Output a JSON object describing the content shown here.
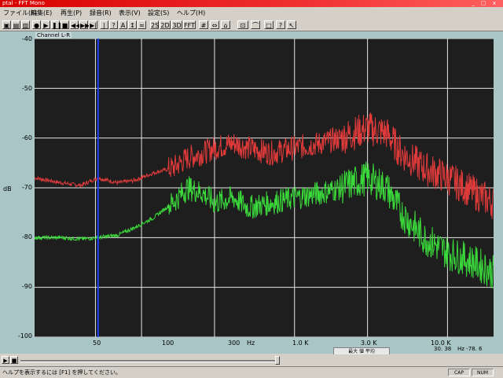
{
  "window": {
    "title": "ptal - FFT Mono",
    "controls": "_ □ x"
  },
  "menu": [
    "ファイル(F)",
    "編集(E)",
    "再生(P)",
    "録音(R)",
    "表示(V)",
    "設定(S)",
    "ヘルプ(H)"
  ],
  "toolbar": [
    "2S",
    "2D",
    "3D",
    "FFT"
  ],
  "graph": {
    "tab_label": "Channel L-R",
    "y_unit": "dB",
    "x_unit": "Hz",
    "y_ticks": [
      "-40",
      "-50",
      "-60",
      "-70",
      "-80",
      "-90",
      "-100"
    ],
    "x_ticks": [
      "50",
      "100",
      "300",
      "1.0 K",
      "3.0 K",
      "10.0 K"
    ],
    "readout_hz": "30. 38",
    "readout_db": "Hz  -78. 6",
    "mini_legend": "最大 値 平均"
  },
  "chart_data": {
    "type": "line",
    "x_scale": "log",
    "xlim": [
      20,
      20000
    ],
    "ylim": [
      -100,
      -40
    ],
    "ylabel": "dB",
    "xlabel": "Hz",
    "grid": true,
    "background": "#1e1e1e",
    "cursor_hz": 52,
    "series": [
      {
        "color": "#e03a3a",
        "x": [
          20,
          30,
          40,
          52,
          70,
          90,
          120,
          160,
          200,
          250,
          300,
          400,
          500,
          700,
          1000,
          1500,
          2000,
          3000,
          4000,
          5000,
          7000,
          10000,
          15000,
          20000
        ],
        "values": [
          -68,
          -69,
          -69.5,
          -68,
          -69,
          -68.5,
          -67,
          -66,
          -64,
          -63,
          -62,
          -61,
          -62,
          -63,
          -62,
          -61,
          -60,
          -58,
          -59,
          -63,
          -66,
          -68,
          -71,
          -73
        ]
      },
      {
        "color": "#3ad83a",
        "x": [
          20,
          30,
          40,
          52,
          70,
          90,
          120,
          160,
          200,
          250,
          300,
          400,
          500,
          700,
          1000,
          1500,
          2000,
          3000,
          4000,
          5000,
          7000,
          10000,
          15000,
          20000
        ],
        "values": [
          -80,
          -80,
          -80.3,
          -80,
          -79.5,
          -78,
          -76,
          -73,
          -70,
          -71,
          -73,
          -72,
          -74,
          -73,
          -72,
          -71,
          -70,
          -68,
          -70,
          -75,
          -80,
          -83,
          -85,
          -87
        ]
      }
    ]
  },
  "status": {
    "message": "ヘルプを表示するには [F1] を押してください。",
    "boxes": [
      "CAP",
      "NUM"
    ]
  }
}
